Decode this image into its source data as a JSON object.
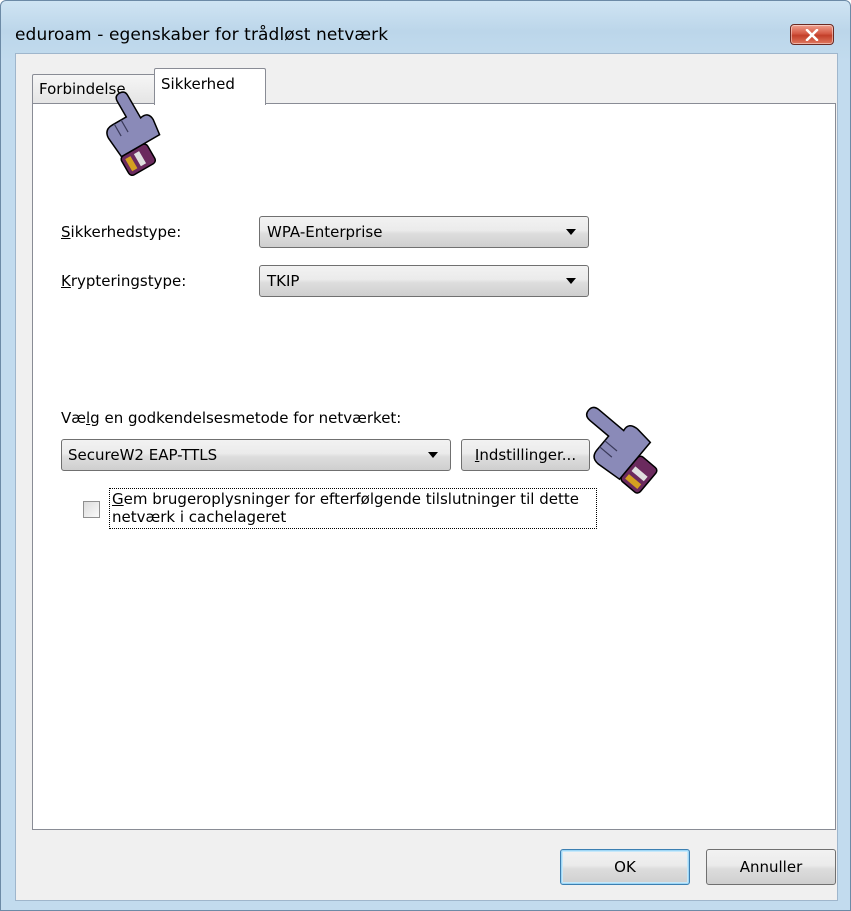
{
  "window": {
    "title": "eduroam - egenskaber for trådløst netværk",
    "close_label": "✕"
  },
  "tabs": [
    {
      "label": "Forbindelse",
      "selected": false
    },
    {
      "label": "Sikkerhed",
      "selected": true
    }
  ],
  "security": {
    "security_type": {
      "label": "Sikkerhedstype:",
      "value": "WPA-Enterprise"
    },
    "encryption_type": {
      "label": "Krypteringstype:",
      "value": "TKIP"
    },
    "auth_method": {
      "label": "Vælg en godkendelsesmetode for netværket:",
      "value": "SecureW2 EAP-TTLS",
      "settings_button": "Indstillinger..."
    },
    "cache_checkbox": {
      "label": "Gem brugeroplysninger for efterfølgende tilslutninger til dette netværk i cachelageret",
      "checked": false
    }
  },
  "footer": {
    "ok_label": "OK",
    "cancel_label": "Annuller"
  },
  "icons": {
    "pointer": "hand-pointer-icon"
  }
}
